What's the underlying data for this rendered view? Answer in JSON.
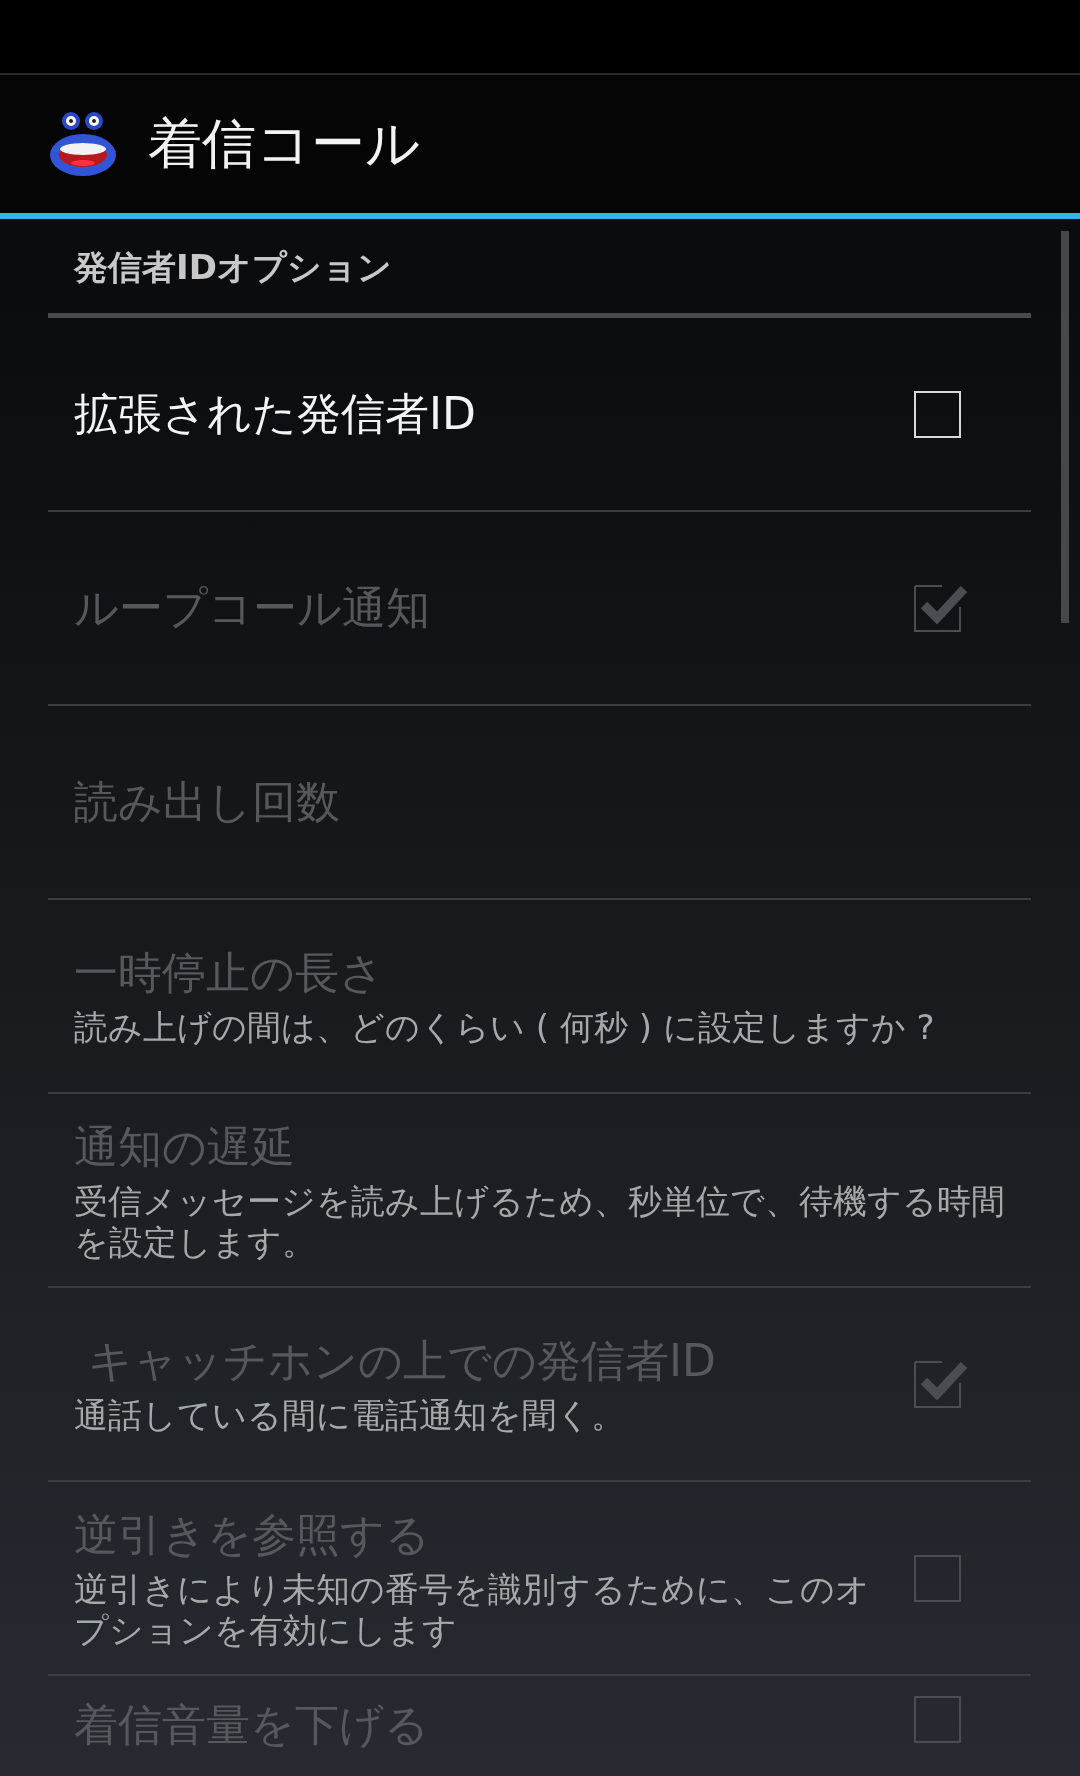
{
  "action_bar": {
    "title": "着信コール"
  },
  "category": {
    "title": "発信者IDオプション"
  },
  "preferences": [
    {
      "kind": "checkbox",
      "title": "拡張された発信者ID",
      "disabled": false,
      "checked": false
    },
    {
      "kind": "checkbox",
      "title": "ループコール通知",
      "disabled": true,
      "checked": true
    },
    {
      "kind": "plain",
      "title": "読み出し回数",
      "disabled": true
    },
    {
      "kind": "plain",
      "title": "一時停止の長さ",
      "summary": "読み上げの間は、どのくらい ( 何秒 ) に設定しますか ?",
      "disabled": true
    },
    {
      "kind": "plain",
      "title": "通知の遅延",
      "summary": "受信メッセージを読み上げるため、秒単位で、待機する時間を設定します。",
      "disabled": true
    },
    {
      "kind": "checkbox",
      "title": " キャッチホンの上での発信者ID",
      "summary": "通話している間に電話通知を聞く。",
      "disabled": true,
      "checked": true
    },
    {
      "kind": "checkbox",
      "title": "逆引きを参照する",
      "summary": "逆引きにより未知の番号を識別するために、このオプションを有効にします",
      "disabled": true,
      "checked": false
    },
    {
      "kind": "checkbox",
      "title": "着信音量を下げる",
      "disabled": true,
      "checked": false
    }
  ]
}
